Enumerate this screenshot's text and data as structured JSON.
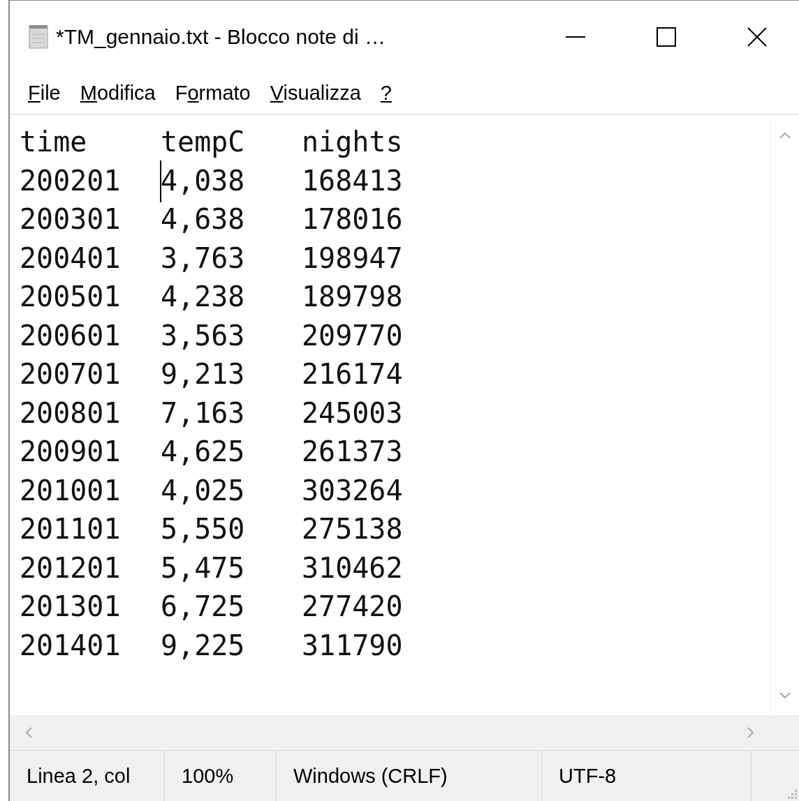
{
  "window": {
    "title": "*TM_gennaio.txt - Blocco note di …"
  },
  "menu": [
    {
      "access_key": "F",
      "rest": "ile"
    },
    {
      "access_key": "M",
      "rest": "odifica"
    },
    {
      "before": "F",
      "access_key": "o",
      "rest": "rmato"
    },
    {
      "access_key": "V",
      "rest": "isualizza"
    },
    {
      "access_key": "?"
    }
  ],
  "lines": [
    {
      "cells": [
        "time",
        "tempC",
        "nights"
      ],
      "caret": false
    },
    {
      "cells": [
        "200201",
        "4,038",
        "168413"
      ],
      "caret": true
    },
    {
      "cells": [
        "200301",
        "4,638",
        "178016"
      ],
      "caret": false
    },
    {
      "cells": [
        "200401",
        "3,763",
        "198947"
      ],
      "caret": false
    },
    {
      "cells": [
        "200501",
        "4,238",
        "189798"
      ],
      "caret": false
    },
    {
      "cells": [
        "200601",
        "3,563",
        "209770"
      ],
      "caret": false
    },
    {
      "cells": [
        "200701",
        "9,213",
        "216174"
      ],
      "caret": false
    },
    {
      "cells": [
        "200801",
        "7,163",
        "245003"
      ],
      "caret": false
    },
    {
      "cells": [
        "200901",
        "4,625",
        "261373"
      ],
      "caret": false
    },
    {
      "cells": [
        "201001",
        "4,025",
        "303264"
      ],
      "caret": false
    },
    {
      "cells": [
        "201101",
        "5,550",
        "275138"
      ],
      "caret": false
    },
    {
      "cells": [
        "201201",
        "5,475",
        "310462"
      ],
      "caret": false
    },
    {
      "cells": [
        "201301",
        "6,725",
        "277420"
      ],
      "caret": false
    },
    {
      "cells": [
        "201401",
        "9,225",
        "311790"
      ],
      "caret": false
    }
  ],
  "status_bar": [
    "Linea 2, col",
    "100%",
    "Windows (CRLF)",
    "UTF-8"
  ]
}
